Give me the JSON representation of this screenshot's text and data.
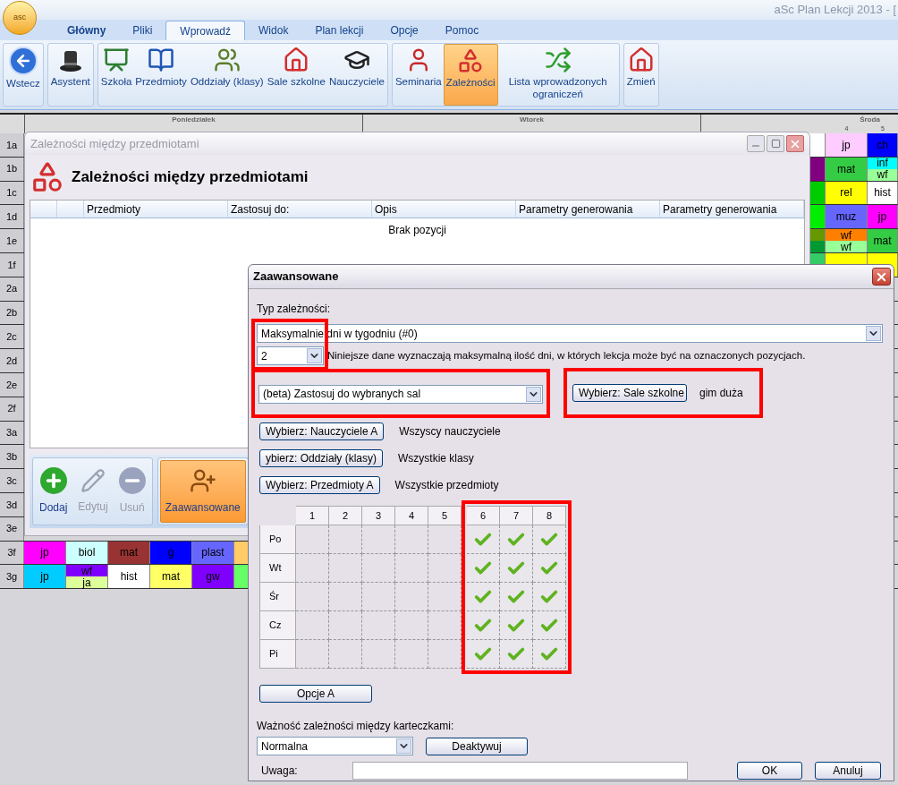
{
  "app": {
    "logo_text": "asc",
    "title": "aSc Plan Lekcji 2013 - ["
  },
  "tabs": [
    {
      "label": "Główny",
      "kind": "menu",
      "selected": false
    },
    {
      "label": "Pliki",
      "kind": "tab",
      "selected": false
    },
    {
      "label": "Wprowadź",
      "kind": "tab",
      "selected": true
    },
    {
      "label": "Widok",
      "kind": "tab",
      "selected": false
    },
    {
      "label": "Plan lekcji",
      "kind": "tab",
      "selected": false
    },
    {
      "label": "Opcje",
      "kind": "tab",
      "selected": false
    },
    {
      "label": "Pomoc",
      "kind": "tab",
      "selected": false
    }
  ],
  "ribbon": {
    "groups": [
      {
        "items": [
          {
            "label": "Wstecz",
            "kind": "back",
            "selected": false
          }
        ]
      },
      {
        "items": [
          {
            "label": "Asystent",
            "kind": "hat",
            "selected": false
          }
        ]
      },
      {
        "items": [
          {
            "label": "Szkoła",
            "kind": "board",
            "selected": false
          },
          {
            "label": "Przedmioty",
            "kind": "book",
            "selected": false
          },
          {
            "label": "Oddziały (klasy)",
            "kind": "group",
            "selected": false
          },
          {
            "label": "Sale szkolne",
            "kind": "house",
            "selected": false
          },
          {
            "label": "Nauczyciele",
            "kind": "teacher",
            "selected": false
          }
        ]
      },
      {
        "items": [
          {
            "label": "Seminaria",
            "kind": "person",
            "selected": false
          },
          {
            "label": "Zależności",
            "kind": "shapes",
            "selected": true
          },
          {
            "label": "Lista wprowadzonych ograniczeń",
            "kind": "shuffle",
            "selected": false
          }
        ]
      },
      {
        "items": [
          {
            "label": "Zmień",
            "kind": "house",
            "selected": false
          }
        ]
      }
    ]
  },
  "timetable": {
    "days": [
      "Poniedziałek",
      "Wtorek",
      "Środa"
    ],
    "periods": [
      "4",
      "5"
    ],
    "rows": [
      {
        "label": "1a",
        "left": [],
        "right": [
          {
            "parts": [
              {
                "color": "#ffffff"
              }
            ]
          },
          {
            "parts": [
              {
                "text": "jp",
                "color": "#ffccff"
              }
            ]
          },
          {
            "parts": [
              {
                "text": "ch",
                "color": "#0000ff"
              }
            ]
          }
        ]
      },
      {
        "label": "1b",
        "left": [],
        "right": [
          {
            "parts": [
              {
                "color": "#800080"
              }
            ]
          },
          {
            "parts": [
              {
                "text": "mat",
                "color": "#33cc44"
              }
            ]
          },
          {
            "parts": [
              {
                "text": "inf",
                "color": "#00ffff"
              },
              {
                "text": "wf",
                "color": "#99ff99"
              }
            ]
          }
        ]
      },
      {
        "label": "1c",
        "left": [],
        "right": [
          {
            "parts": [
              {
                "color": "#00cc00"
              }
            ]
          },
          {
            "parts": [
              {
                "text": "rel",
                "color": "#ffff00"
              }
            ]
          },
          {
            "parts": [
              {
                "text": "hist",
                "color": "#ffffff"
              }
            ]
          }
        ]
      },
      {
        "label": "1d",
        "left": [],
        "right": [
          {
            "parts": [
              {
                "color": "#00ee00"
              }
            ]
          },
          {
            "parts": [
              {
                "text": "muz",
                "color": "#6666ff"
              }
            ]
          },
          {
            "parts": [
              {
                "text": "jp",
                "color": "#ff00ff"
              }
            ]
          }
        ]
      },
      {
        "label": "1e",
        "left": [],
        "right": [
          {
            "parts": [
              {
                "color": "#669900"
              },
              {
                "color": "#009933"
              }
            ]
          },
          {
            "parts": [
              {
                "text": "wf",
                "color": "#ff8000"
              },
              {
                "text": "wf",
                "color": "#99ff99"
              }
            ]
          },
          {
            "parts": [
              {
                "text": "mat",
                "color": "#33cc44"
              }
            ]
          }
        ]
      },
      {
        "label": "1f",
        "left": [],
        "right": [
          {
            "parts": [
              {
                "color": "#33cc66"
              }
            ]
          },
          {
            "parts": [
              {
                "color": "#ffff00"
              }
            ]
          },
          {
            "parts": [
              {
                "color": "#ffff00"
              }
            ]
          }
        ]
      },
      {
        "label": "2a",
        "left": [],
        "right": []
      },
      {
        "label": "2b",
        "left": [],
        "right": []
      },
      {
        "label": "2c",
        "left": [],
        "right": []
      },
      {
        "label": "2d",
        "left": [],
        "right": []
      },
      {
        "label": "2e",
        "left": [],
        "right": []
      },
      {
        "label": "2f",
        "left": [],
        "right": []
      },
      {
        "label": "3a",
        "left": [],
        "right": []
      },
      {
        "label": "3b",
        "left": [],
        "right": []
      },
      {
        "label": "3c",
        "left": [],
        "right": []
      },
      {
        "label": "3d",
        "left": [],
        "right": []
      },
      {
        "label": "3e",
        "left": [],
        "right": []
      },
      {
        "label": "3f",
        "left": [
          {
            "parts": [
              {
                "text": "jp",
                "color": "#ff00ff"
              }
            ]
          },
          {
            "parts": [
              {
                "text": "biol",
                "color": "#ccffff"
              }
            ]
          },
          {
            "parts": [
              {
                "text": "mat",
                "color": "#993333"
              }
            ]
          },
          {
            "parts": [
              {
                "text": "g",
                "color": "#0000ff"
              }
            ]
          },
          {
            "parts": [
              {
                "text": "plast",
                "color": "#6666ff"
              }
            ]
          },
          {
            "parts": [
              {
                "color": "#ffcc66"
              }
            ]
          }
        ],
        "right": []
      },
      {
        "label": "3g",
        "left": [
          {
            "parts": [
              {
                "text": "jp",
                "color": "#00ccff"
              }
            ]
          },
          {
            "parts": [
              {
                "text": "wf",
                "color": "#8000ff"
              },
              {
                "text": "ja",
                "color": "#ddff99"
              }
            ]
          },
          {
            "parts": [
              {
                "text": "hist",
                "color": "#ffffff"
              }
            ]
          },
          {
            "parts": [
              {
                "text": "mat",
                "color": "#ffff66"
              }
            ]
          },
          {
            "parts": [
              {
                "text": "gw",
                "color": "#8000ff"
              }
            ]
          },
          {
            "parts": [
              {
                "color": "#66ff66"
              }
            ]
          }
        ],
        "right": []
      }
    ]
  },
  "dependencies_window": {
    "title": "Zależności między przedmiotami",
    "heading": "Zależności między przedmiotami",
    "columns": [
      "Przedmioty",
      "Zastosuj do:",
      "Opis",
      "Parametry generowania",
      "Parametry generowania"
    ],
    "empty_text": "Brak pozycji",
    "toolbar": [
      {
        "items": [
          {
            "label": "Dodaj",
            "kind": "add",
            "disabled": false,
            "selected": false
          },
          {
            "label": "Edytuj",
            "kind": "edit",
            "disabled": true,
            "selected": false
          },
          {
            "label": "Usuń",
            "kind": "remove",
            "disabled": true,
            "selected": false
          }
        ]
      },
      {
        "items": [
          {
            "label": "Zaawansowane",
            "kind": "advanced",
            "disabled": false,
            "selected": true
          }
        ]
      }
    ]
  },
  "advanced_dialog": {
    "title": "Zaawansowane",
    "type_label": "Typ zależności:",
    "type_value": "Maksymalnie dni w tygodniu (#0)",
    "count_value": "2",
    "description": "Niniejsze dane wyznaczają maksymalną ilość dni, w których lekcja może być na oznaczonych pozycjach.",
    "scope_value": "(beta) Zastosuj do wybranych sal",
    "rooms_button": "Wybierz: Sale szkolne",
    "rooms_value": "gim duża",
    "filters": [
      {
        "button": "Wybierz: Nauczyciele A",
        "value": "Wszyscy nauczyciele"
      },
      {
        "button": "ybierz: Oddziały (klasy)",
        "value": "Wszystkie klasy"
      },
      {
        "button": "Wybierz: Przedmioty A",
        "value": "Wszystkie przedmioty"
      }
    ],
    "grid": {
      "columns": [
        "1",
        "2",
        "3",
        "4",
        "5",
        "6",
        "7",
        "8"
      ],
      "rows": [
        {
          "label": "Po",
          "checked": [
            false,
            false,
            false,
            false,
            false,
            true,
            true,
            true
          ]
        },
        {
          "label": "Wt",
          "checked": [
            false,
            false,
            false,
            false,
            false,
            true,
            true,
            true
          ]
        },
        {
          "label": "Śr",
          "checked": [
            false,
            false,
            false,
            false,
            false,
            true,
            true,
            true
          ]
        },
        {
          "label": "Cz",
          "checked": [
            false,
            false,
            false,
            false,
            false,
            true,
            true,
            true
          ]
        },
        {
          "label": "Pi",
          "checked": [
            false,
            false,
            false,
            false,
            false,
            true,
            true,
            true
          ]
        }
      ]
    },
    "options_button": "Opcje A",
    "importance_label": "Ważność zależności między karteczkami:",
    "importance_value": "Normalna",
    "deactivate_button": "Deaktywuj",
    "note_label": "Uwaga:",
    "ok_button": "OK",
    "cancel_button": "Anuluj"
  }
}
